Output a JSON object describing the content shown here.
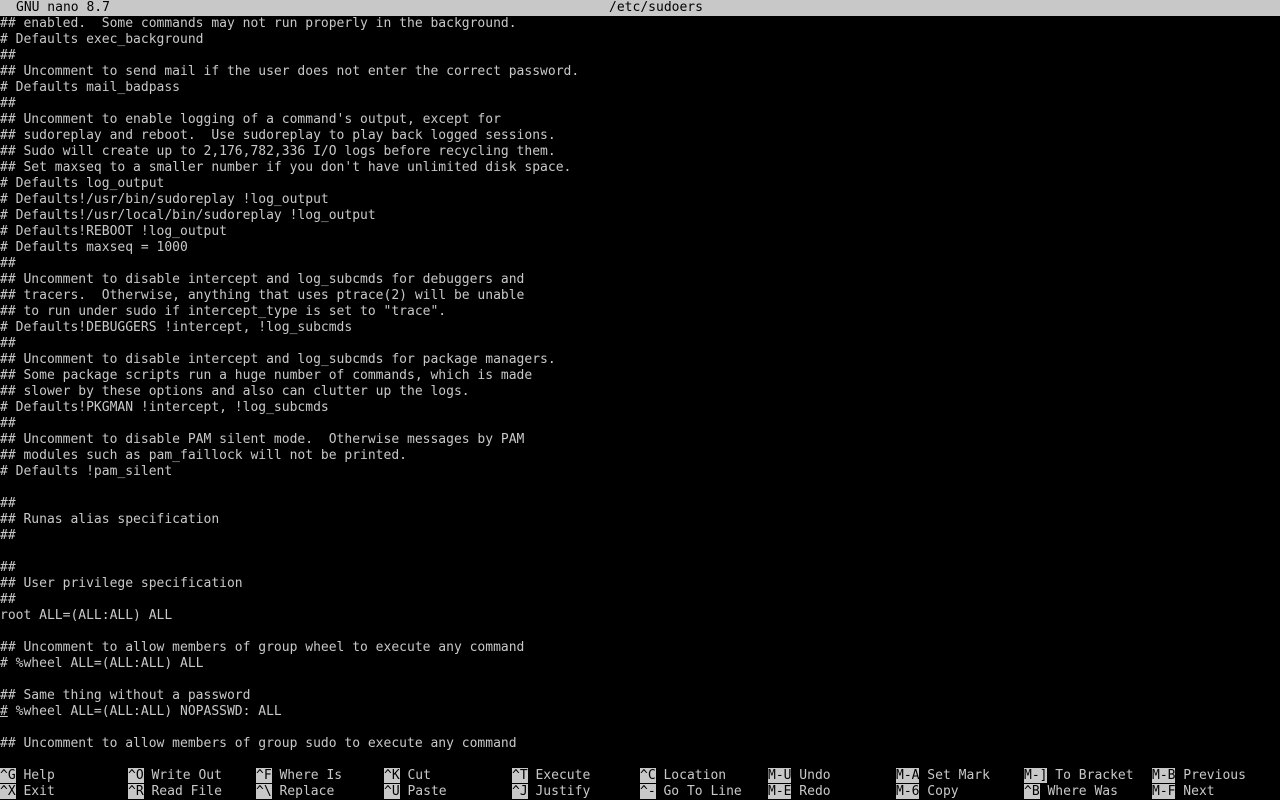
{
  "title_bar": {
    "app": "GNU nano 8.7",
    "file": "/etc/sudoers"
  },
  "editor_lines": [
    "## enabled.  Some commands may not run properly in the background.",
    "# Defaults exec_background",
    "##",
    "## Uncomment to send mail if the user does not enter the correct password.",
    "# Defaults mail_badpass",
    "##",
    "## Uncomment to enable logging of a command's output, except for",
    "## sudoreplay and reboot.  Use sudoreplay to play back logged sessions.",
    "## Sudo will create up to 2,176,782,336 I/O logs before recycling them.",
    "## Set maxseq to a smaller number if you don't have unlimited disk space.",
    "# Defaults log_output",
    "# Defaults!/usr/bin/sudoreplay !log_output",
    "# Defaults!/usr/local/bin/sudoreplay !log_output",
    "# Defaults!REBOOT !log_output",
    "# Defaults maxseq = 1000",
    "##",
    "## Uncomment to disable intercept and log_subcmds for debuggers and",
    "## tracers.  Otherwise, anything that uses ptrace(2) will be unable",
    "## to run under sudo if intercept_type is set to \"trace\".",
    "# Defaults!DEBUGGERS !intercept, !log_subcmds",
    "##",
    "## Uncomment to disable intercept and log_subcmds for package managers.",
    "## Some package scripts run a huge number of commands, which is made",
    "## slower by these options and also can clutter up the logs.",
    "# Defaults!PKGMAN !intercept, !log_subcmds",
    "##",
    "## Uncomment to disable PAM silent mode.  Otherwise messages by PAM",
    "## modules such as pam_faillock will not be printed.",
    "# Defaults !pam_silent",
    "",
    "##",
    "## Runas alias specification",
    "##",
    "",
    "##",
    "## User privilege specification",
    "##",
    "root ALL=(ALL:ALL) ALL",
    "",
    "## Uncomment to allow members of group wheel to execute any command",
    "# %wheel ALL=(ALL:ALL) ALL",
    "",
    "## Same thing without a password",
    "# %wheel ALL=(ALL:ALL) NOPASSWD: ALL",
    "",
    "## Uncomment to allow members of group sudo to execute any command"
  ],
  "cursor_line_index": 43,
  "shortcuts_row1": [
    {
      "key": "^G",
      "label": "Help"
    },
    {
      "key": "^O",
      "label": "Write Out"
    },
    {
      "key": "^F",
      "label": "Where Is"
    },
    {
      "key": "^K",
      "label": "Cut"
    },
    {
      "key": "^T",
      "label": "Execute"
    },
    {
      "key": "^C",
      "label": "Location"
    },
    {
      "key": "M-U",
      "label": "Undo"
    },
    {
      "key": "M-A",
      "label": "Set Mark"
    },
    {
      "key": "M-]",
      "label": "To Bracket"
    },
    {
      "key": "M-B",
      "label": "Previous"
    }
  ],
  "shortcuts_row2": [
    {
      "key": "^X",
      "label": "Exit"
    },
    {
      "key": "^R",
      "label": "Read File"
    },
    {
      "key": "^\\",
      "label": "Replace"
    },
    {
      "key": "^U",
      "label": "Paste"
    },
    {
      "key": "^J",
      "label": "Justify"
    },
    {
      "key": "^-",
      "label": "Go To Line"
    },
    {
      "key": "M-E",
      "label": "Redo"
    },
    {
      "key": "M-6",
      "label": "Copy"
    },
    {
      "key": "^B",
      "label": "Where Was"
    },
    {
      "key": "M-F",
      "label": "Next"
    }
  ],
  "colors": {
    "background": "#000000",
    "foreground": "#c8c8c8",
    "inverse_bg": "#c8c8c8",
    "inverse_fg": "#000000"
  }
}
